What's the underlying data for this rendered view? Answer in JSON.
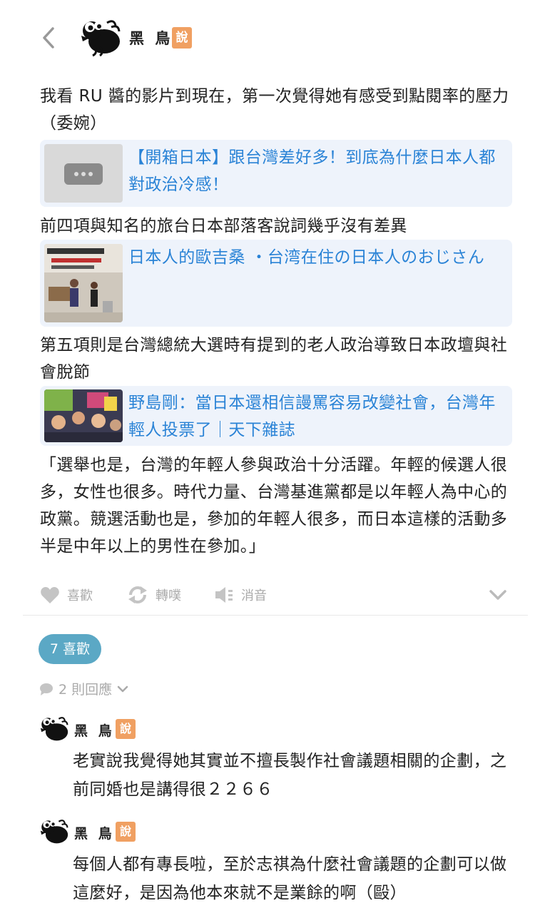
{
  "header": {
    "author_name": "黑 鳥",
    "badge": "說"
  },
  "post": {
    "paragraphs": [
      "我看 RU 醬的影片到現在，第一次覺得她有感受到點閱率的壓力（委婉）",
      "前四項與知名的旅台日本部落客說詞幾乎沒有差異",
      "第五項則是台灣總統大選時有提到的老人政治導致日本政壇與社會脫節",
      "「選舉也是，台灣的年輕人參與政治十分活躍。年輕的候選人很多，女性也很多。時代力量、台灣基進黨都是以年輕人為中心的政黨。競選活動也是，參加的年輕人很多，而日本這樣的活動多半是中年以上的男性在參加。」"
    ],
    "cards": [
      {
        "title": "【開箱日本】跟台灣差好多！到底為什麼日本人都對政治冷感！",
        "thumb": "placeholder-icon"
      },
      {
        "title": "日本人的歐吉桑 ・台湾在住の日本人のおじさん",
        "thumb": "video-thumbnail"
      },
      {
        "title": "野島剛：當日本還相信謾罵容易改變社會，台灣年輕人投票了｜天下雜誌",
        "thumb": "crowd-photo-thumbnail"
      }
    ]
  },
  "actions": {
    "like": "喜歡",
    "repost": "轉噗",
    "mute": "消音"
  },
  "likes_pill": "7 喜歡",
  "replies": {
    "count_label": "2 則回應",
    "items": [
      {
        "author": "黑 鳥",
        "badge": "說",
        "text": "老實說我覺得她其實並不擅長製作社會議題相關的企劃，之前同婚也是講得很２２６６"
      },
      {
        "author": "黑 鳥",
        "badge": "說",
        "text": "每個人都有專長啦，至於志祺為什麼社會議題的企劃可以做這麼好，是因為他本來就不是業餘的啊（毆）"
      }
    ]
  },
  "colors": {
    "link": "#2a83d6",
    "badge": "#f0a062",
    "like_pill": "#5ba8c5",
    "card_bg": "#eef3fb"
  }
}
